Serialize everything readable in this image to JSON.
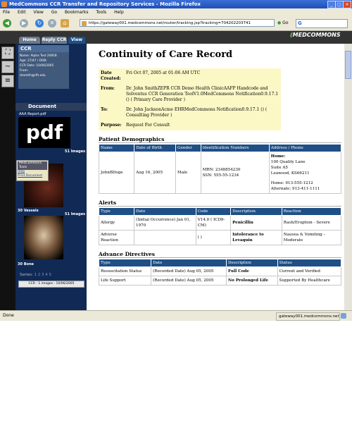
{
  "window": {
    "title": "MedCommons CCR Transfer and Repository Services - Mozilla Firefox",
    "menu": [
      "File",
      "Edit",
      "View",
      "Go",
      "Bookmarks",
      "Tools",
      "Help"
    ],
    "url": "https://gateway001.medcommons.net/router/tracking.jsp?tracking=704202203741",
    "go_label": "Go",
    "search_glyph": "G",
    "status_left": "Done",
    "status_right": "gateway001.medcommons.net"
  },
  "app": {
    "tabs": [
      "Home",
      "Reply CCR",
      "View"
    ],
    "logo_prefix": "(",
    "logo_text": "MEDCOMMONS"
  },
  "sidebar": {
    "ccr_title": "CCR",
    "ccr_info": [
      "Name:    Alpha Test 20818",
      "Age: 27/47 / DOB:",
      "CCR Date:    10/06/2005",
      "From:",
      "    dromith@rfh.edu"
    ],
    "document_title": "Document",
    "document_name": "AAA Report.pdf",
    "pdf_text": "pdf",
    "series_ctl_title": "MedCommons Tools",
    "series_ctl_items": [
      "Help",
      "Print Document"
    ],
    "images": [
      {
        "count": "51 Images",
        "caption": "30 Vessels"
      },
      {
        "count": "51 Images",
        "caption": "30 Bone"
      }
    ],
    "series_label": "Series:",
    "series_numbers": "1 2 3 4 5",
    "ccr_bar": "CCR - 1 images - 10/06/2005"
  },
  "doc": {
    "title": "Continuity of Care Record",
    "meta": [
      {
        "k": "Date Created:",
        "v": "Fri Oct 07, 2005 at 01:06 AM UTC"
      },
      {
        "k": "From:",
        "v": "Dr. John SmithZEPR CCR Demo Health ClinicAAFP Handcode and Solventus CCR Generation ToolV1.0MedCommons Notification0.9.17.1 () ( Primary Care Provider )"
      },
      {
        "k": "To:",
        "v": "Dr. John JacksonAcme EHRMedCommons Notification0.9.17.1 () ( Consulting Provider )"
      },
      {
        "k": "Purpose:",
        "v": "Request For Consult"
      }
    ],
    "demographics_title": "Patient Demographics",
    "demographics_headers": [
      "Name",
      "Date of Birth",
      "Gender",
      "Identification Numbers",
      "Address / Phone"
    ],
    "demographics_row": {
      "name": "JohnBDoge",
      "dob": "Aug 16, 2005",
      "gender": "Male",
      "mrn": "MRN: 2348854230",
      "ssn": "SSN: 555-55-1234",
      "address": [
        "Home:",
        "100 Quality Lane",
        "Suite A5",
        "Leawood, KS66211",
        "",
        "Home: 913-555-1212",
        "Alternate: 913-411-1111"
      ]
    },
    "alerts_title": "Alerts",
    "alerts_headers": [
      "Type",
      "Date",
      "Code",
      "Description",
      "Reaction"
    ],
    "alerts_rows": [
      [
        "Allergy",
        "(Initial Occurrence) Jan 01, 1970",
        "V14.0 ( ICD9-CM)",
        "Penicillin",
        "Rash/Eruption - Severe"
      ],
      [
        "Adverse Reaction",
        "",
        "( )",
        "Intolerance to Levaquin",
        "Nausea & Vomiting - Moderate"
      ]
    ],
    "directives_title": "Advance Directives",
    "directives_headers": [
      "Type",
      "Date",
      "Description",
      "Status"
    ],
    "directives_rows": [
      [
        "Resuscitation Status",
        "(Recorded Date) Aug 05, 2005",
        "Full Code",
        "Current and Verified"
      ],
      [
        "Life Support",
        "(Recorded Date) Aug 05, 2005",
        "No Prolonged Life",
        "Supported By Healthcare"
      ]
    ]
  }
}
